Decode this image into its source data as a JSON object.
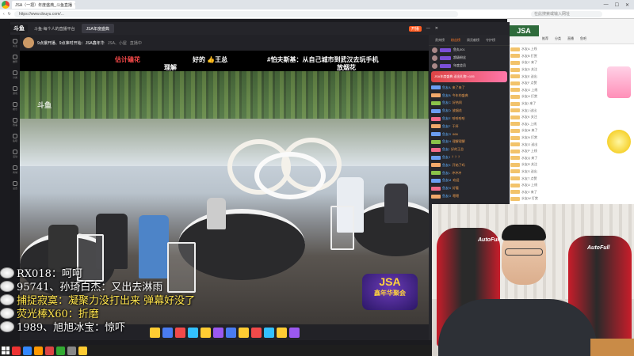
{
  "browser": {
    "tab_title": "JSA（一把）年度盛典_斗鱼直播",
    "url": "https://www.douyu.com/...",
    "search_placeholder": "在此搜索或输入网址",
    "controls": [
      "—",
      "☐",
      "✕"
    ]
  },
  "app": {
    "logo": "斗鱼",
    "tabs": [
      {
        "label": "斗鱼·每个人的直播平台",
        "active": false
      },
      {
        "label": "JSA年度盛典",
        "active": true
      }
    ],
    "live_badge": "开播",
    "rail": [
      "关注",
      "推荐",
      "分类",
      "游戏",
      "娱乐",
      "赛事",
      "鱼吧",
      "活动",
      "商城",
      "设置"
    ]
  },
  "room": {
    "title": "9点爆开播、9点准时开始：JSA鑫年华",
    "subtitle": "JSA、小屋",
    "meta": "直播中"
  },
  "video": {
    "watermark": "斗鱼",
    "logo_top": "JSA",
    "logo_bottom": "鑫年华聚会",
    "danmu": [
      {
        "text": "估计磕花",
        "color": "#ff4b4b"
      },
      {
        "text": "好的 👍王总",
        "color": "#ffffff"
      },
      {
        "text": "#怕夫斯基：从自己城市到武汉去玩手机",
        "color": "#ffffff"
      },
      {
        "text": "理解",
        "color": "#ffffff"
      },
      {
        "text": "放烟花",
        "color": "#ffffff"
      }
    ]
  },
  "overlay_comments": [
    {
      "text": "RX018：呵呵",
      "highlight": false
    },
    {
      "text": "95741、孙琦白杰：又出去淋雨",
      "highlight": false
    },
    {
      "text": "捕捉寂寞：凝聚力没打出来 弹幕好没了",
      "highlight": true
    },
    {
      "text": "荧光棒X60：折磨",
      "highlight": true
    },
    {
      "text": "1989、旭旭冰宝：惊吓",
      "highlight": false
    }
  ],
  "chat": {
    "tabs": [
      "贵宾榜",
      "粉丝榜",
      "周贡献榜",
      "守护榜"
    ],
    "ranks": [
      "鱼丸001",
      "超级粉丝",
      "年度会员"
    ],
    "banner": "JSA年度盛典 送出礼物 ×105",
    "messages": [
      {
        "name": "鱼友A",
        "text": "来了来了",
        "lvl": "#6b9ef2"
      },
      {
        "name": "鱼友B",
        "text": "今年的盛典",
        "lvl": "#f2a96b"
      },
      {
        "name": "鱼友C",
        "text": "好热闹",
        "lvl": "#8bc34a"
      },
      {
        "name": "鱼友D",
        "text": "放烟花",
        "lvl": "#6b9ef2"
      },
      {
        "name": "鱼友E",
        "text": "哈哈哈哈",
        "lvl": "#f26b8a"
      },
      {
        "name": "鱼友F",
        "text": "干杯",
        "lvl": "#f2a96b"
      },
      {
        "name": "鱼友G",
        "text": "666",
        "lvl": "#6b9ef2"
      },
      {
        "name": "鱼友H",
        "text": "理解理解",
        "lvl": "#8bc34a"
      },
      {
        "name": "鱼友I",
        "text": "好的王总",
        "lvl": "#f26b8a"
      },
      {
        "name": "鱼友J",
        "text": "？？？",
        "lvl": "#6b9ef2"
      },
      {
        "name": "鱼友K",
        "text": "开始了吗",
        "lvl": "#f2a96b"
      },
      {
        "name": "鱼友L",
        "text": "冲冲冲",
        "lvl": "#8bc34a"
      },
      {
        "name": "鱼友M",
        "text": "欢迎",
        "lvl": "#6b9ef2"
      },
      {
        "name": "鱼友N",
        "text": "好看",
        "lvl": "#f26b8a"
      },
      {
        "name": "鱼友O",
        "text": "嗯嗯",
        "lvl": "#f2a96b"
      }
    ]
  },
  "bg_page": {
    "banner": "JSA",
    "nav": [
      "推荐",
      "分类",
      "直播",
      "鱼吧"
    ],
    "rows": [
      "水友A 上线",
      "水友B 打赏",
      "水友C 来了",
      "水友D 关注",
      "水友E 送出",
      "水友F 点赞",
      "水友G 上线",
      "水友H 打赏",
      "水友I 来了",
      "水友J 送出",
      "水友K 关注",
      "水友L 上线",
      "水友M 来了",
      "水友N 打赏",
      "水友O 送出",
      "水友P 上线",
      "水友Q 来了",
      "水友R 关注",
      "水友S 送出",
      "水友T 点赞",
      "水友U 上线",
      "水友V 来了",
      "水友W 打赏"
    ]
  },
  "cam": {
    "brand": "AutoFull"
  },
  "gift_colors": [
    "#ffcc33",
    "#4a7cf2",
    "#f24a4a",
    "#33c1ff",
    "#ffcc33",
    "#9b59f0",
    "#4a7cf2",
    "#ffcc33",
    "#f24a4a",
    "#33c1ff",
    "#ffcc33",
    "#9b59f0"
  ],
  "taskbar_icons": [
    "#e33",
    "#38f",
    "#f90",
    "#d44",
    "#3a3",
    "#888",
    "#fc3"
  ]
}
